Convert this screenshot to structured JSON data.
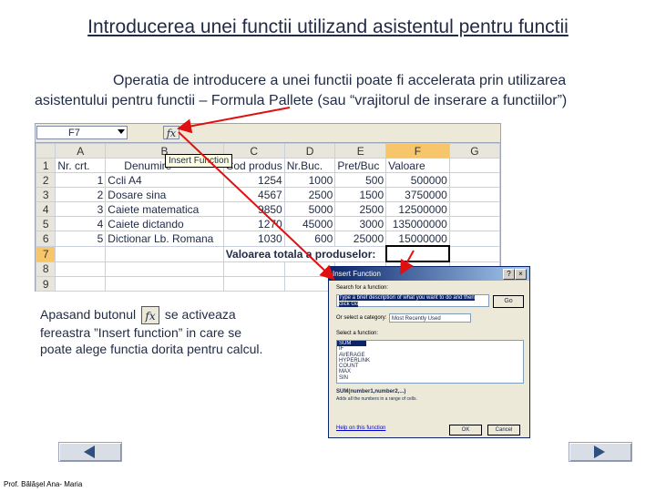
{
  "title": "Introducerea unei functii utilizand asistentul pentru functii",
  "intro": {
    "line1": "Operatia de introducere a unei functii poate fi accelerata prin utilizarea",
    "line2": "asistentului pentru functii – Formula Pallete (sau “vrajitorul de inserare a functiilor”)"
  },
  "spreadsheet": {
    "name_box": "F7",
    "fx_label": "fx",
    "tooltip": "Insert Function",
    "columns": [
      "A",
      "B",
      "C",
      "D",
      "E",
      "F",
      "G"
    ],
    "row_numbers": [
      "1",
      "2",
      "3",
      "4",
      "5",
      "6",
      "7",
      "8",
      "9"
    ],
    "header_row": [
      "Nr. crt.",
      "Denumire",
      "Cod produs",
      "Nr.Buc.",
      "Pret/Buc",
      "Valoare"
    ],
    "rows": [
      [
        "1",
        "Ccli A4",
        "1254",
        "1000",
        "500",
        "500000"
      ],
      [
        "2",
        "Dosare sina",
        "4567",
        "2500",
        "1500",
        "3750000"
      ],
      [
        "3",
        "Caiete matematica",
        "9850",
        "5000",
        "2500",
        "12500000"
      ],
      [
        "4",
        "Caiete dictando",
        "1270",
        "45000",
        "3000",
        "135000000"
      ],
      [
        "5",
        "Dictionar Lb. Romana",
        "1030",
        "600",
        "25000",
        "15000000"
      ]
    ],
    "total_label": "Valoarea totala a produselor:"
  },
  "dialog": {
    "title": "Insert Function",
    "help_btn": "?",
    "close_btn": "×",
    "search_label": "Search for a function:",
    "search_text": "Type a brief description of what you want to do and then click Go",
    "go_button": "Go",
    "category_label": "Or select a category:",
    "category_value": "Most Recently Used",
    "select_label": "Select a function:",
    "functions": [
      "SUM",
      "IF",
      "AVERAGE",
      "HYPERLINK",
      "COUNT",
      "MAX",
      "SIN"
    ],
    "syntax": "SUM(number1,number2,...)",
    "description": "Adds all the numbers in a range of cells.",
    "help_link": "Help on this function",
    "ok_button": "OK",
    "cancel_button": "Cancel"
  },
  "caption": {
    "part1": "Apasand butonul",
    "fx": "fx",
    "part2": "se activeaza",
    "line2": "fereastra ”Insert function” in care se",
    "line3": "poate alege functia dorita pentru calcul."
  },
  "footer": {
    "author": "Prof. Bălăşel Ana- Maria"
  },
  "colors": {
    "arrow": "#e01010",
    "text": "#1f2a44",
    "dialog_title": "#0a246a"
  }
}
